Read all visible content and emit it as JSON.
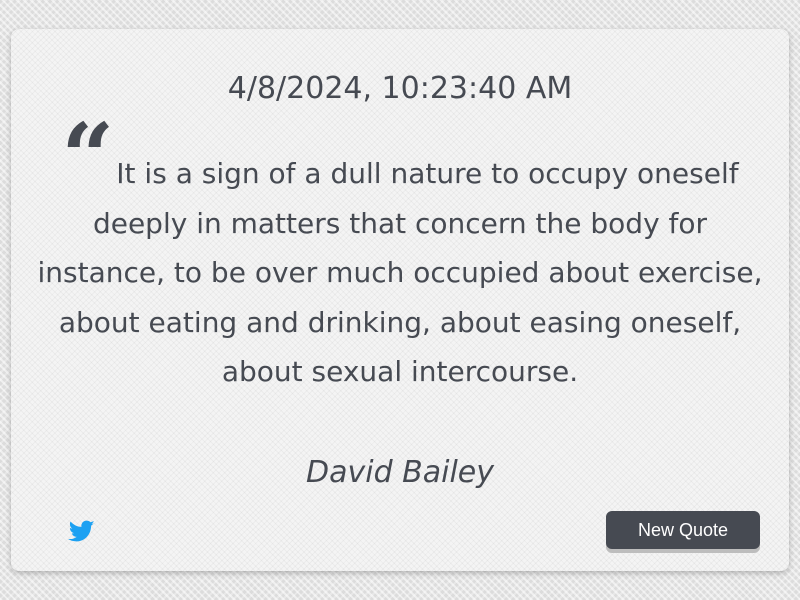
{
  "timestamp": "4/8/2024, 10:23:40 AM",
  "quote": {
    "mark": "“",
    "text": "It is a sign of a dull nature to occupy oneself deeply in matters that concern the body for instance, to be over much occupied about exercise, about eating and drinking, about easing oneself, about sexual intercourse.",
    "author": "David Bailey"
  },
  "actions": {
    "tweet_icon": "twitter-icon",
    "new_quote_label": "New Quote"
  },
  "colors": {
    "text": "#464a52",
    "button": "#464a52",
    "twitter": "#1da1f2"
  }
}
